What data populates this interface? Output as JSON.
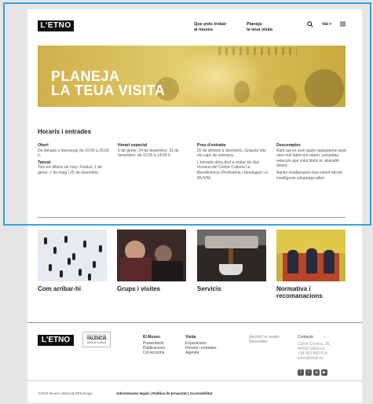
{
  "header": {
    "logo": "L'ETNO",
    "nav": [
      {
        "line1": "Que pots trobar",
        "line2": "al museu"
      },
      {
        "line1": "Planeja",
        "line2": "la teua visita"
      }
    ],
    "language": "Val",
    "icons": {
      "search": "search-icon",
      "menu": "hamburger-menu-icon"
    }
  },
  "hero": {
    "line1": "PLANEJA",
    "line2": "LA TEUA VISITA",
    "color": "#d8bd52"
  },
  "hours": {
    "title": "Horaris i entrades",
    "columns": [
      {
        "heading": "Obert",
        "text": "De dimarts a diumenge de 10:00 a 20:00 h.",
        "heading2": "Tancat",
        "text2": "Tots els dilluns de l'any. Festius: 1 de gener, 1 de maig i 25 de desembre."
      },
      {
        "heading": "Horari especial",
        "text": "5 de gener, 24 de desembre, 31 de desembre: de 10:00 a 14:00 h."
      },
      {
        "heading": "Preu d'entrada",
        "text": "2€ de dimarts a divendres. Gratuïts tots els caps de setmana.",
        "text2": "L'entrada dóna dret a visitar els dos museus del Centre Cultural La Beneficència (Prehistòria i Etnologia) i el MUVIM."
      },
      {
        "heading": "Descomptes",
        "text": "Nam aut ex eum quam quiasperion post, nam rest laborrum ratam, soluptatia velecum que volut litatis et, aliquiditi dolent.",
        "text2": "Agnim imodipsaerio bea volorit derum invelligenis soluptaqui alitat."
      }
    ]
  },
  "cards": [
    {
      "label": "Com arribar-hi"
    },
    {
      "label": "Grups i visites"
    },
    {
      "label": "Servicis"
    },
    {
      "label": "Normativa i recomanacions"
    }
  ],
  "footer": {
    "logo": "L'ETNO",
    "diputacio": {
      "top": "DIPUTACIÓ DE",
      "name": "VALÈNCIA",
      "sub": "Àrea de Cultura"
    },
    "museu": {
      "title": "El Museu",
      "items": [
        "Presentació",
        "Publicacions",
        "Col·leccions"
      ]
    },
    "visita": {
      "title": "Visita",
      "items": [
        "Exposicions",
        "Horaris i entrades",
        "Agenda"
      ]
    },
    "newsletter": "Apunta't al nostre Newsletter",
    "contact": {
      "label": "Contacte",
      "lines": [
        "Carrer Corona, 36.",
        "46003 València.",
        "+34 963 883 614",
        "letno@dival.es"
      ]
    },
    "social": [
      "facebook-icon",
      "twitter-icon",
      "instagram-icon",
      "youtube-icon"
    ],
    "copyright": "©2020 Museu Valencià d'Etnologia",
    "legal": "Advertencies legals | Política de privacitat | Accessibilitat"
  }
}
